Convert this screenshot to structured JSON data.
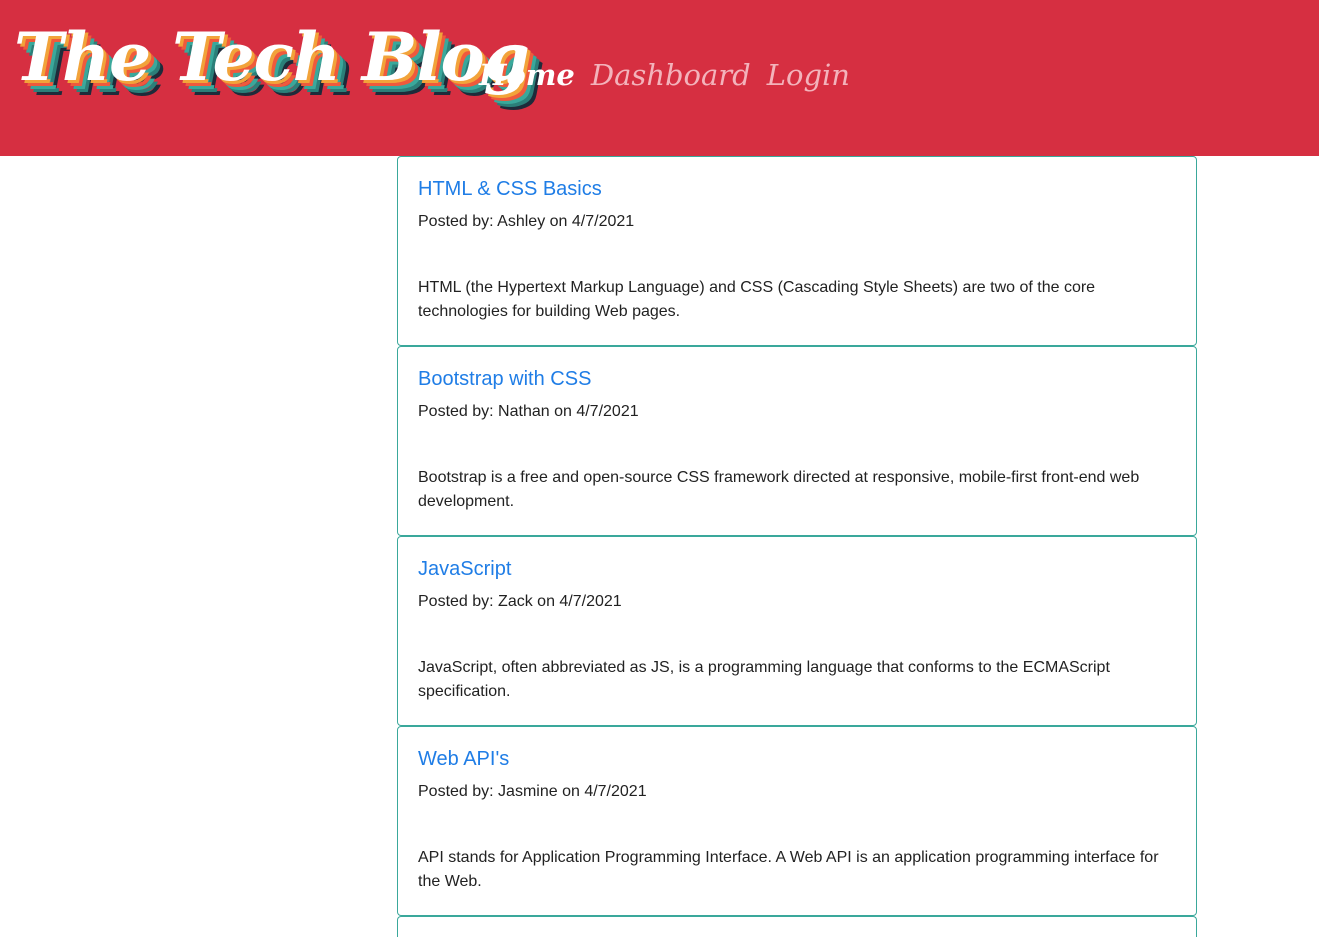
{
  "header": {
    "logo_text": "The Tech Blog",
    "nav": [
      {
        "label": "Home"
      },
      {
        "label": "Dashboard"
      },
      {
        "label": "Login"
      }
    ]
  },
  "posts": [
    {
      "title": "HTML & CSS Basics",
      "meta": "Posted by: Ashley on 4/7/2021",
      "body": "HTML (the Hypertext Markup Language) and CSS (Cascading Style Sheets) are two of the core technologies for building Web pages."
    },
    {
      "title": "Bootstrap with CSS",
      "meta": "Posted by: Nathan on 4/7/2021",
      "body": "Bootstrap is a free and open-source CSS framework directed at responsive, mobile-first front-end web development."
    },
    {
      "title": "JavaScript",
      "meta": "Posted by: Zack on 4/7/2021",
      "body": "JavaScript, often abbreviated as JS, is a programming language that conforms to the ECMAScript specification."
    },
    {
      "title": "Web API's",
      "meta": "Posted by: Jasmine on 4/7/2021",
      "body": "API stands for Application Programming Interface. A Web API is an application programming interface for the Web."
    }
  ],
  "colors": {
    "header_bg": "#d62f41",
    "link": "#1f7de6",
    "card_border": "#3aa89b",
    "nav_active": "#ffffff",
    "nav_inactive": "#f3b3bb"
  }
}
